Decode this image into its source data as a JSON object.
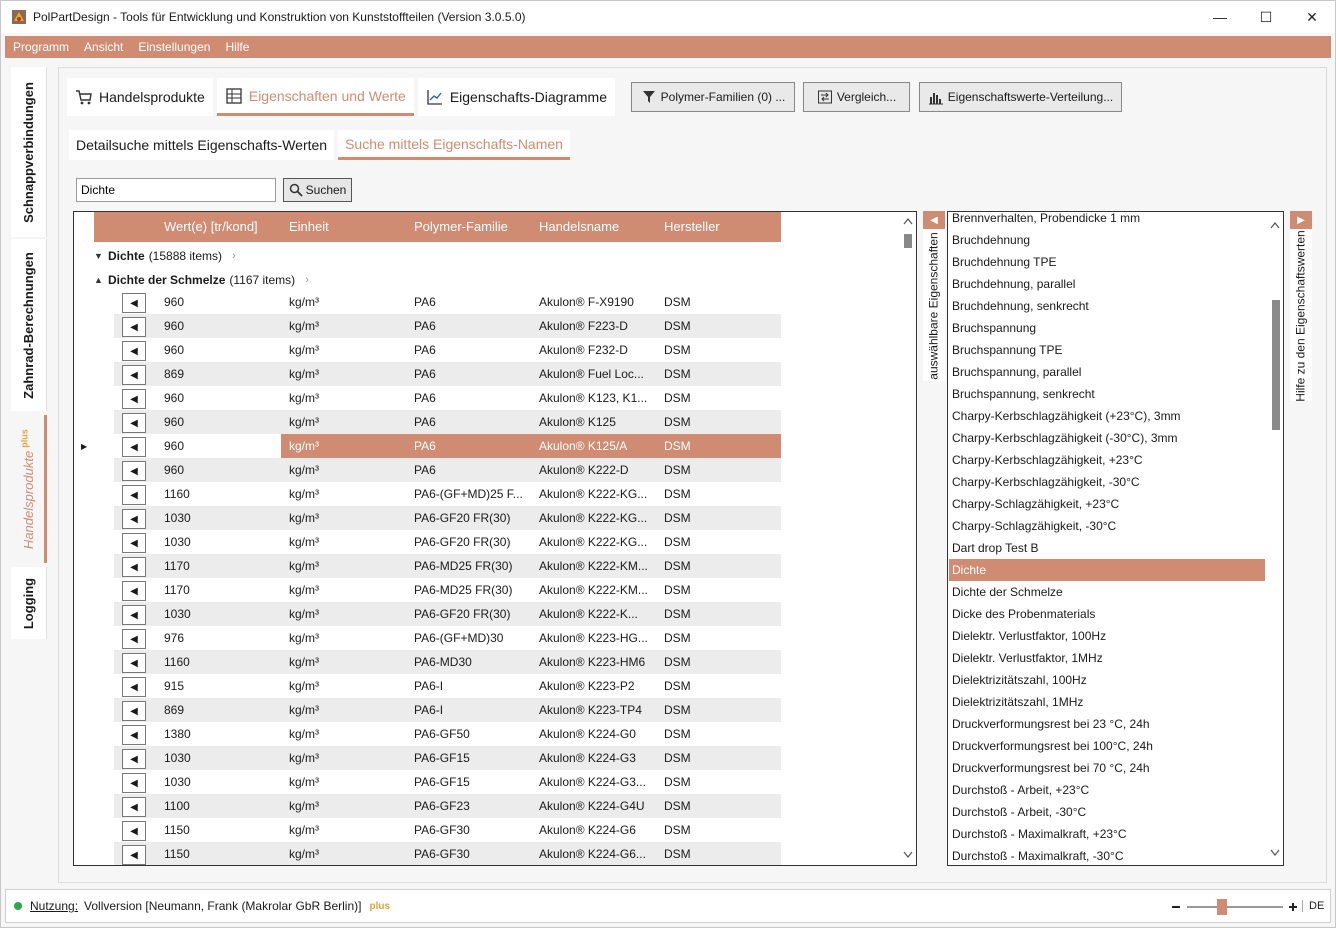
{
  "window": {
    "title": "PolPartDesign - Tools für Entwicklung und Konstruktion von Kunststoffteilen (Version 3.0.5.0)",
    "min": "—",
    "max": "☐",
    "close": "✕"
  },
  "menu": [
    "Programm",
    "Ansicht",
    "Einstellungen",
    "Hilfe"
  ],
  "sidetabs": {
    "schnapp": "Schnappverbindungen",
    "zahnrad": "Zahnrad-Berechnungen",
    "handel": "Handelsprodukte",
    "handel_plus": "plus",
    "logging": "Logging"
  },
  "toptabs": {
    "handel": "Handelsprodukte",
    "eigenschaften": "Eigenschaften und Werte",
    "diagramme": "Eigenschafts-Diagramme"
  },
  "toolbar": {
    "familien": "Polymer-Familien (0) ...",
    "vergleich": "Vergleich...",
    "verteilung": "Eigenschaftswerte-Verteilung..."
  },
  "subtabs": {
    "detail": "Detailsuche mittels Eigenschafts-Werten",
    "namen": "Suche mittels Eigenschafts-Namen"
  },
  "search": {
    "value": "Dichte",
    "button": "Suchen"
  },
  "grid": {
    "headers": [
      "Wert(e) [tr/kond]",
      "Einheit",
      "Polymer-Familie",
      "Handelsname",
      "Hersteller"
    ],
    "groups": [
      {
        "name": "Dichte",
        "count": "(15888 items)"
      },
      {
        "name": "Dichte der Schmelze",
        "count": "(1167 items)"
      }
    ],
    "unit": "kg/m³",
    "rows": [
      {
        "wert": "960",
        "familie": "PA6",
        "name": "Akulon® F-X9190",
        "hersteller": "DSM"
      },
      {
        "wert": "960",
        "familie": "PA6",
        "name": "Akulon® F223-D",
        "hersteller": "DSM"
      },
      {
        "wert": "960",
        "familie": "PA6",
        "name": "Akulon® F232-D",
        "hersteller": "DSM"
      },
      {
        "wert": "869",
        "familie": "PA6",
        "name": "Akulon® Fuel Loc...",
        "hersteller": "DSM"
      },
      {
        "wert": "960",
        "familie": "PA6",
        "name": "Akulon® K123, K1...",
        "hersteller": "DSM"
      },
      {
        "wert": "960",
        "familie": "PA6",
        "name": "Akulon® K125",
        "hersteller": "DSM"
      },
      {
        "wert": "960",
        "familie": "PA6",
        "name": "Akulon® K125/A",
        "hersteller": "DSM"
      },
      {
        "wert": "960",
        "familie": "PA6",
        "name": "Akulon® K222-D",
        "hersteller": "DSM"
      },
      {
        "wert": "1160",
        "familie": "PA6-(GF+MD)25 F...",
        "name": "Akulon® K222-KG...",
        "hersteller": "DSM"
      },
      {
        "wert": "1030",
        "familie": "PA6-GF20 FR(30)",
        "name": "Akulon® K222-KG...",
        "hersteller": "DSM"
      },
      {
        "wert": "1030",
        "familie": "PA6-GF20 FR(30)",
        "name": "Akulon® K222-KG...",
        "hersteller": "DSM"
      },
      {
        "wert": "1170",
        "familie": "PA6-MD25 FR(30)",
        "name": "Akulon® K222-KM...",
        "hersteller": "DSM"
      },
      {
        "wert": "1170",
        "familie": "PA6-MD25 FR(30)",
        "name": "Akulon® K222-KM...",
        "hersteller": "DSM"
      },
      {
        "wert": "1030",
        "familie": "PA6-GF20 FR(30)",
        "name": "Akulon® K222-K...",
        "hersteller": "DSM"
      },
      {
        "wert": "976",
        "familie": "PA6-(GF+MD)30",
        "name": "Akulon® K223-HG...",
        "hersteller": "DSM"
      },
      {
        "wert": "1160",
        "familie": "PA6-MD30",
        "name": "Akulon® K223-HM6",
        "hersteller": "DSM"
      },
      {
        "wert": "915",
        "familie": "PA6-I",
        "name": "Akulon® K223-P2",
        "hersteller": "DSM"
      },
      {
        "wert": "869",
        "familie": "PA6-I",
        "name": "Akulon® K223-TP4",
        "hersteller": "DSM"
      },
      {
        "wert": "1380",
        "familie": "PA6-GF50",
        "name": "Akulon® K224-G0",
        "hersteller": "DSM"
      },
      {
        "wert": "1030",
        "familie": "PA6-GF15",
        "name": "Akulon® K224-G3",
        "hersteller": "DSM"
      },
      {
        "wert": "1030",
        "familie": "PA6-GF15",
        "name": "Akulon® K224-G3...",
        "hersteller": "DSM"
      },
      {
        "wert": "1100",
        "familie": "PA6-GF23",
        "name": "Akulon® K224-G4U",
        "hersteller": "DSM"
      },
      {
        "wert": "1150",
        "familie": "PA6-GF30",
        "name": "Akulon® K224-G6",
        "hersteller": "DSM"
      },
      {
        "wert": "1150",
        "familie": "PA6-GF30",
        "name": "Akulon® K224-G6...",
        "hersteller": "DSM"
      }
    ],
    "selected_index": 6
  },
  "panels": {
    "left_label": "auswählbare Eigenschaften",
    "right_label": "Hilfe zu den Eigenschaftswerten"
  },
  "properties": [
    "Brennverhalten, Probendicke 1 mm",
    "Bruchdehnung",
    "Bruchdehnung TPE",
    "Bruchdehnung, parallel",
    "Bruchdehnung, senkrecht",
    "Bruchspannung",
    "Bruchspannung TPE",
    "Bruchspannung, parallel",
    "Bruchspannung, senkrecht",
    "Charpy-Kerbschlagzähigkeit (+23°C), 3mm",
    "Charpy-Kerbschlagzähigkeit (-30°C), 3mm",
    "Charpy-Kerbschlagzähigkeit, +23°C",
    "Charpy-Kerbschlagzähigkeit, -30°C",
    "Charpy-Schlagzähigkeit, +23°C",
    "Charpy-Schlagzähigkeit, -30°C",
    "Dart drop Test B",
    "Dichte",
    "Dichte der Schmelze",
    "Dicke des Probenmaterials",
    "Dielektr. Verlustfaktor, 100Hz",
    "Dielektr. Verlustfaktor, 1MHz",
    "Dielektrizitätszahl, 100Hz",
    "Dielektrizitätszahl, 1MHz",
    "Druckverformungsrest  bei 23 °C, 24h",
    "Druckverformungsrest bei 100°C, 24h",
    "Druckverformungsrest bei 70 °C, 24h",
    "Durchstoß - Arbeit, +23°C",
    "Durchstoß - Arbeit, -30°C",
    "Durchstoß - Maximalkraft, +23°C",
    "Durchstoß - Maximalkraft, -30°C"
  ],
  "properties_selected_index": 16,
  "status": {
    "label": "Nutzung:",
    "text": "Vollversion [Neumann, Frank (Makrolar GbR Berlin)]",
    "plus": "plus",
    "lang": "DE"
  }
}
